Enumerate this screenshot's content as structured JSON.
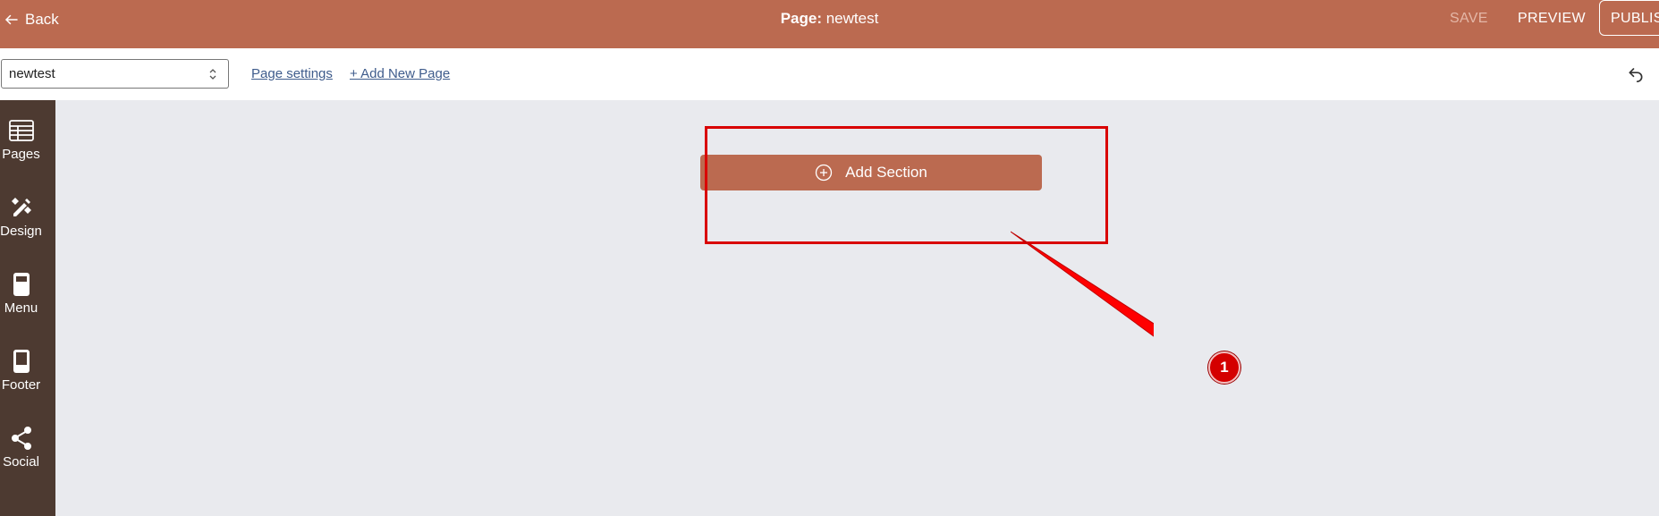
{
  "topbar": {
    "back_label": "Back",
    "title_prefix": "Page:",
    "title_page": "newtest",
    "save_label": "SAVE",
    "preview_label": "PREVIEW",
    "publish_label": "PUBLIS"
  },
  "toolbar": {
    "page_select_value": "newtest",
    "page_settings_label": "Page settings",
    "add_new_page_label": "+ Add New Page"
  },
  "sidebar": {
    "items": [
      {
        "label": "Pages",
        "icon": "table-icon"
      },
      {
        "label": "Design",
        "icon": "design-tools-icon"
      },
      {
        "label": "Menu",
        "icon": "menu-layout-icon"
      },
      {
        "label": "Footer",
        "icon": "footer-layout-icon"
      },
      {
        "label": "Social",
        "icon": "share-icon"
      }
    ]
  },
  "canvas": {
    "add_section_label": "Add Section"
  },
  "annotation": {
    "badge_number": "1",
    "color": "#d90000"
  },
  "colors": {
    "brand": "#bb6a50",
    "sidebar": "#4d3a31",
    "canvas": "#e9eaee",
    "link": "#3f5c8c"
  }
}
